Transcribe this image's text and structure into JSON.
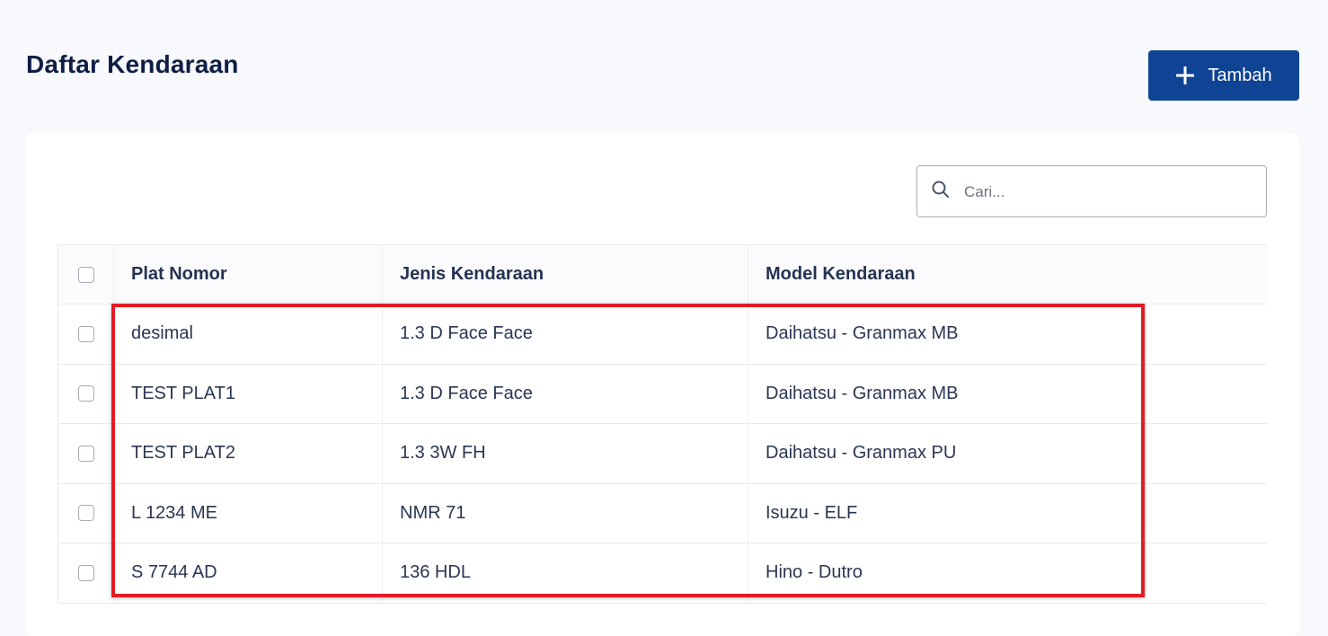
{
  "page": {
    "title": "Daftar Kendaraan"
  },
  "header": {
    "add_button_label": "Tambah",
    "add_button_icon": "plus-icon"
  },
  "search": {
    "placeholder": "Cari...",
    "value": "",
    "icon": "search-icon"
  },
  "table": {
    "columns": [
      "Plat Nomor",
      "Jenis Kendaraan",
      "Model Kendaraan"
    ],
    "rows": [
      {
        "plat": "desimal",
        "jenis": "1.3 D Face Face",
        "model": "Daihatsu - Granmax MB"
      },
      {
        "plat": "TEST PLAT1",
        "jenis": "1.3 D Face Face",
        "model": "Daihatsu - Granmax MB"
      },
      {
        "plat": "TEST PLAT2",
        "jenis": "1.3 3W FH",
        "model": "Daihatsu - Granmax PU"
      },
      {
        "plat": "L 1234 ME",
        "jenis": "NMR 71",
        "model": "Isuzu - ELF"
      },
      {
        "plat": "S 7744 AD",
        "jenis": "136 HDL",
        "model": "Hino - Dutro"
      }
    ]
  },
  "colors": {
    "primary": "#0f4393",
    "highlight": "#e31b23",
    "background": "#f8f9fc",
    "title": "#0f1e46"
  }
}
